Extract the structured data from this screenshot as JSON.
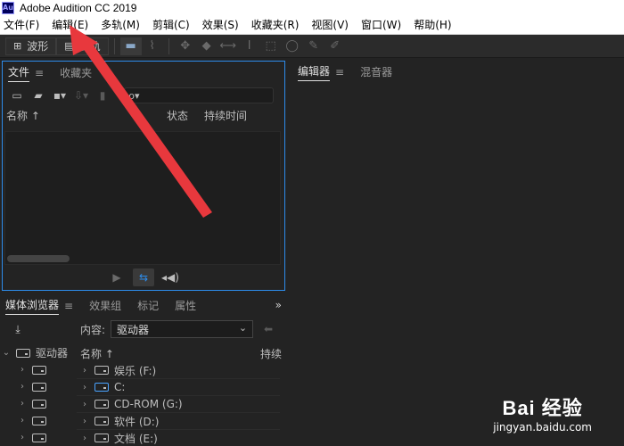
{
  "window": {
    "app_icon_text": "Au",
    "title": "Adobe Audition CC 2019"
  },
  "menubar": [
    "文件(F)",
    "编辑(E)",
    "多轨(M)",
    "剪辑(C)",
    "效果(S)",
    "收藏夹(R)",
    "视图(V)",
    "窗口(W)",
    "帮助(H)"
  ],
  "toolbar": {
    "waveform_label": "波形",
    "multitrack_label": "多轨"
  },
  "files_panel": {
    "tabs": [
      "文件",
      "收藏夹"
    ],
    "menu_glyph": "≡",
    "columns": {
      "name": "名称",
      "status": "状态",
      "duration": "持续时间"
    },
    "search_glyph": "ρ▾"
  },
  "editor_panel": {
    "tabs": [
      "编辑器",
      "混音器"
    ],
    "menu_glyph": "≡"
  },
  "media_panel": {
    "tabs": [
      "媒体浏览器",
      "效果组",
      "标记",
      "属性"
    ],
    "overflow_glyph": "»",
    "content_label": "内容:",
    "content_value": "驱动器",
    "tree_root": "驱动器",
    "list_header": {
      "name": "名称",
      "duration": "持续"
    },
    "drives": [
      "娱乐 (F:)",
      "C:",
      "CD-ROM (G:)",
      "软件 (D:)",
      "文档 (E:)"
    ],
    "left_tree_items": [
      "",
      "",
      "",
      "",
      ""
    ]
  },
  "watermark": {
    "brand": "Bai 经验",
    "url": "jingyan.baidu.com"
  },
  "colors": {
    "accent": "#2d8ceb",
    "annotation_arrow": "#e8383d"
  }
}
